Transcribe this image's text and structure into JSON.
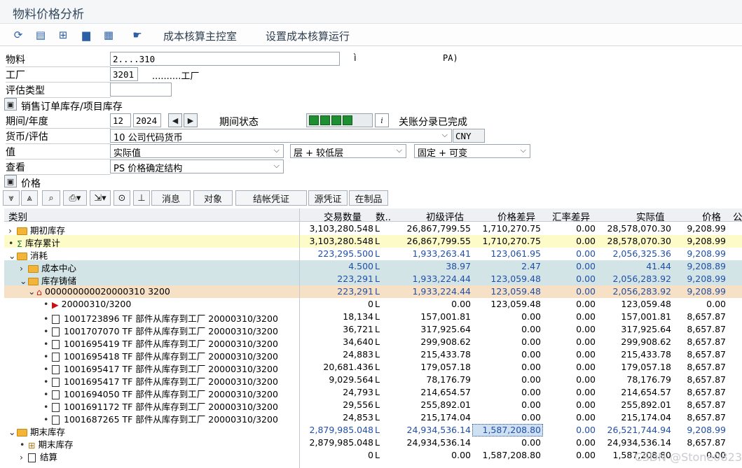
{
  "window": {
    "title": "物料价格分析"
  },
  "toolbar": {
    "icons": [
      "refresh-icon",
      "layout-icon",
      "hierarchy-icon",
      "save-icon",
      "table-icon",
      "hand-icon"
    ],
    "links": [
      "成本核算主控室",
      "设置成本核算运行"
    ]
  },
  "form": {
    "material_label": "物料",
    "material_value": "2....310",
    "material_marker": "ì",
    "material_extra": "PA)",
    "plant_label": "工厂",
    "plant_value": "3201",
    "plant_desc": "..........工厂",
    "valtype_label": "评估类型",
    "valtype_value": "",
    "sales_order_label": "销售订单库存/项目库存",
    "period_label": "期间/年度",
    "period_value": "12",
    "year_value": "2024",
    "period_status_label": "期间状态",
    "period_status_text": "关账分录已完成",
    "currency_label": "货币/评估",
    "currency_value": "10 公司代码货币",
    "currency_code": "CNY",
    "value_label": "值",
    "value_sel": "实际值",
    "layer_sel": "层 + 较低层",
    "fixvar_sel": "固定 + 可变",
    "view_label": "查看",
    "view_sel": "PS 价格确定结构",
    "price_section": "价格"
  },
  "grid_toolbar": [
    "消息",
    "对象",
    "结帐凭证",
    "源凭证",
    "在制品"
  ],
  "grid": {
    "columns": [
      "类别",
      "交易数量",
      "数..",
      "初级评估",
      "价格差异",
      "汇率差异",
      "实际值",
      "价格",
      "公"
    ],
    "rows": [
      {
        "category": "期初库存",
        "qty": "3,103,280.548",
        "unit": "L",
        "primary": "26,867,799.55",
        "pricediff": "1,710,270.75",
        "exdiff": "0.00",
        "actual": "28,578,070.30",
        "price": "9,208.99"
      },
      {
        "category": "库存累计",
        "qty": "3,103,280.548",
        "unit": "L",
        "primary": "26,867,799.55",
        "pricediff": "1,710,270.75",
        "exdiff": "0.00",
        "actual": "28,578,070.30",
        "price": "9,208.99"
      },
      {
        "category": "消耗",
        "qty": "223,295.500",
        "unit": "L",
        "primary": "1,933,263.41",
        "pricediff": "123,061.95",
        "exdiff": "0.00",
        "actual": "2,056,325.36",
        "price": "9,208.99"
      },
      {
        "category": "成本中心",
        "qty": "4.500",
        "unit": "L",
        "primary": "38.97",
        "pricediff": "2.47",
        "exdiff": "0.00",
        "actual": "41.44",
        "price": "9,208.89"
      },
      {
        "category": "库存铸储",
        "qty": "223,291",
        "unit": "L",
        "primary": "1,933,224.44",
        "pricediff": "123,059.48",
        "exdiff": "0.00",
        "actual": "2,056,283.92",
        "price": "9,208.99"
      },
      {
        "category": "000000000020000310 3200",
        "qty": "223,291",
        "unit": "L",
        "primary": "1,933,224.44",
        "pricediff": "123,059.48",
        "exdiff": "0.00",
        "actual": "2,056,283.92",
        "price": "9,208.99"
      },
      {
        "category": "20000310/3200",
        "qty": "0",
        "unit": "L",
        "primary": "0.00",
        "pricediff": "123,059.48",
        "exdiff": "0.00",
        "actual": "123,059.48",
        "price": "0.00"
      },
      {
        "category": "1001723896 TF 部件从库存到工厂 20000310/3200",
        "qty": "18,134",
        "unit": "L",
        "primary": "157,001.81",
        "pricediff": "0.00",
        "exdiff": "0.00",
        "actual": "157,001.81",
        "price": "8,657.87"
      },
      {
        "category": "1001707070 TF 部件从库存到工厂 20000310/3200",
        "qty": "36,721",
        "unit": "L",
        "primary": "317,925.64",
        "pricediff": "0.00",
        "exdiff": "0.00",
        "actual": "317,925.64",
        "price": "8,657.87"
      },
      {
        "category": "1001695419 TF 部件从库存到工厂 20000310/3200",
        "qty": "34,640",
        "unit": "L",
        "primary": "299,908.62",
        "pricediff": "0.00",
        "exdiff": "0.00",
        "actual": "299,908.62",
        "price": "8,657.87"
      },
      {
        "category": "1001695418 TF 部件从库存到工厂 20000310/3200",
        "qty": "24,883",
        "unit": "L",
        "primary": "215,433.78",
        "pricediff": "0.00",
        "exdiff": "0.00",
        "actual": "215,433.78",
        "price": "8,657.87"
      },
      {
        "category": "1001695417 TF 部件从库存到工厂 20000310/3200",
        "qty": "20,681.436",
        "unit": "L",
        "primary": "179,057.18",
        "pricediff": "0.00",
        "exdiff": "0.00",
        "actual": "179,057.18",
        "price": "8,657.87"
      },
      {
        "category": "1001695417 TF 部件从库存到工厂 20000310/3200",
        "qty": "9,029.564",
        "unit": "L",
        "primary": "78,176.79",
        "pricediff": "0.00",
        "exdiff": "0.00",
        "actual": "78,176.79",
        "price": "8,657.87"
      },
      {
        "category": "1001694050 TF 部件从库存到工厂 20000310/3200",
        "qty": "24,793",
        "unit": "L",
        "primary": "214,654.57",
        "pricediff": "0.00",
        "exdiff": "0.00",
        "actual": "214,654.57",
        "price": "8,657.87"
      },
      {
        "category": "1001691172 TF 部件从库存到工厂 20000310/3200",
        "qty": "29,556",
        "unit": "L",
        "primary": "255,892.01",
        "pricediff": "0.00",
        "exdiff": "0.00",
        "actual": "255,892.01",
        "price": "8,657.87"
      },
      {
        "category": "1001687265 TF 部件从库存到工厂 20000310/3200",
        "qty": "24,853",
        "unit": "L",
        "primary": "215,174.04",
        "pricediff": "0.00",
        "exdiff": "0.00",
        "actual": "215,174.04",
        "price": "8,657.87"
      },
      {
        "category": "期末库存",
        "qty": "2,879,985.048",
        "unit": "L",
        "primary": "24,934,536.14",
        "pricediff": "1,587,208.80",
        "exdiff": "0.00",
        "actual": "26,521,744.94",
        "price": "9,208.99"
      },
      {
        "category": "期末库存",
        "qty": "2,879,985.048",
        "unit": "L",
        "primary": "24,934,536.14",
        "pricediff": "0.00",
        "exdiff": "0.00",
        "actual": "24,934,536.14",
        "price": "8,657.87"
      },
      {
        "category": "结算",
        "qty": "0",
        "unit": "L",
        "primary": "0.00",
        "pricediff": "1,587,208.80",
        "exdiff": "0.00",
        "actual": "1,587,208.80",
        "price": "0.00"
      }
    ]
  },
  "watermark": "CSDN @Stone0823"
}
